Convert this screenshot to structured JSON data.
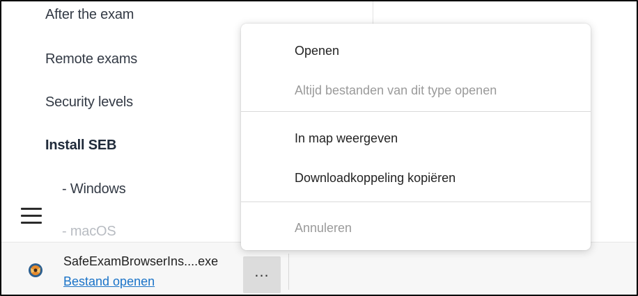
{
  "sidebar": {
    "items": [
      {
        "label": "After the exam"
      },
      {
        "label": "Remote exams"
      },
      {
        "label": "Security levels"
      },
      {
        "label": "Install SEB"
      },
      {
        "label": "- Windows"
      },
      {
        "label": "- macOS"
      }
    ]
  },
  "hamburger": {
    "icon": "hamburger-menu-icon"
  },
  "download": {
    "file_name": "SafeExamBrowserIns....exe",
    "open_link": "Bestand openen",
    "more_label": "..."
  },
  "context_menu": {
    "items": [
      {
        "label": "Openen",
        "enabled": true
      },
      {
        "label": "Altijd bestanden van dit type openen",
        "enabled": false
      },
      {
        "label": "In map weergeven",
        "enabled": true
      },
      {
        "label": "Downloadkoppeling kopiëren",
        "enabled": true
      },
      {
        "label": "Annuleren",
        "enabled": false
      }
    ]
  },
  "colors": {
    "link": "#1a73c8",
    "text": "#333a45",
    "disabled": "#9a9a9a"
  }
}
